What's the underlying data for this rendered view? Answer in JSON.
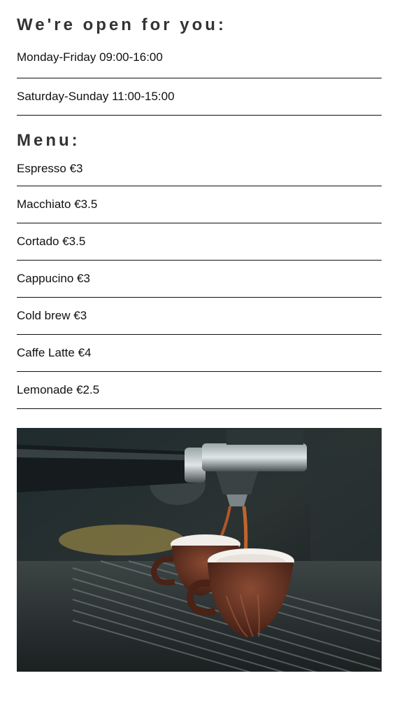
{
  "hours": {
    "title": "We're open for you:",
    "items": [
      "Monday-Friday 09:00-16:00",
      "Saturday-Sunday 11:00-15:00"
    ]
  },
  "menu": {
    "title": "Menu:",
    "items": [
      "Espresso €3",
      "Macchiato €3.5",
      "Cortado €3.5",
      "Cappucino €3",
      "Cold brew €3",
      "Caffe Latte €4",
      "Lemonade €2.5"
    ]
  },
  "photo": {
    "icon": "espresso-machine-photo"
  }
}
